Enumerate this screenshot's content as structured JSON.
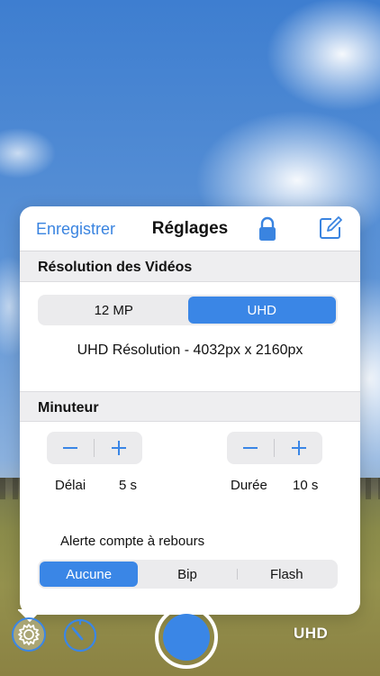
{
  "navbar": {
    "left_button": "Enregistrer",
    "title": "Réglages",
    "lock_icon": "lock-icon",
    "compose_icon": "compose-icon"
  },
  "video_resolution": {
    "header": "Résolution des Vidéos",
    "options": [
      "12 MP",
      "UHD"
    ],
    "selected": "UHD",
    "description": "UHD Résolution - 4032px x 2160px"
  },
  "timer": {
    "header": "Minuteur",
    "delay": {
      "label": "Délai",
      "value": "5 s"
    },
    "duration": {
      "label": "Durée",
      "value": "10 s"
    },
    "countdown_alert_label": "Alerte compte à rebours",
    "alert_options": [
      "Aucune",
      "Bip",
      "Flash"
    ],
    "alert_selected": "Aucune"
  },
  "toolbar": {
    "mode_label": "UHD",
    "settings_icon": "gear-icon",
    "timer_icon": "timer-icon",
    "accent_color": "#3a86e6"
  }
}
